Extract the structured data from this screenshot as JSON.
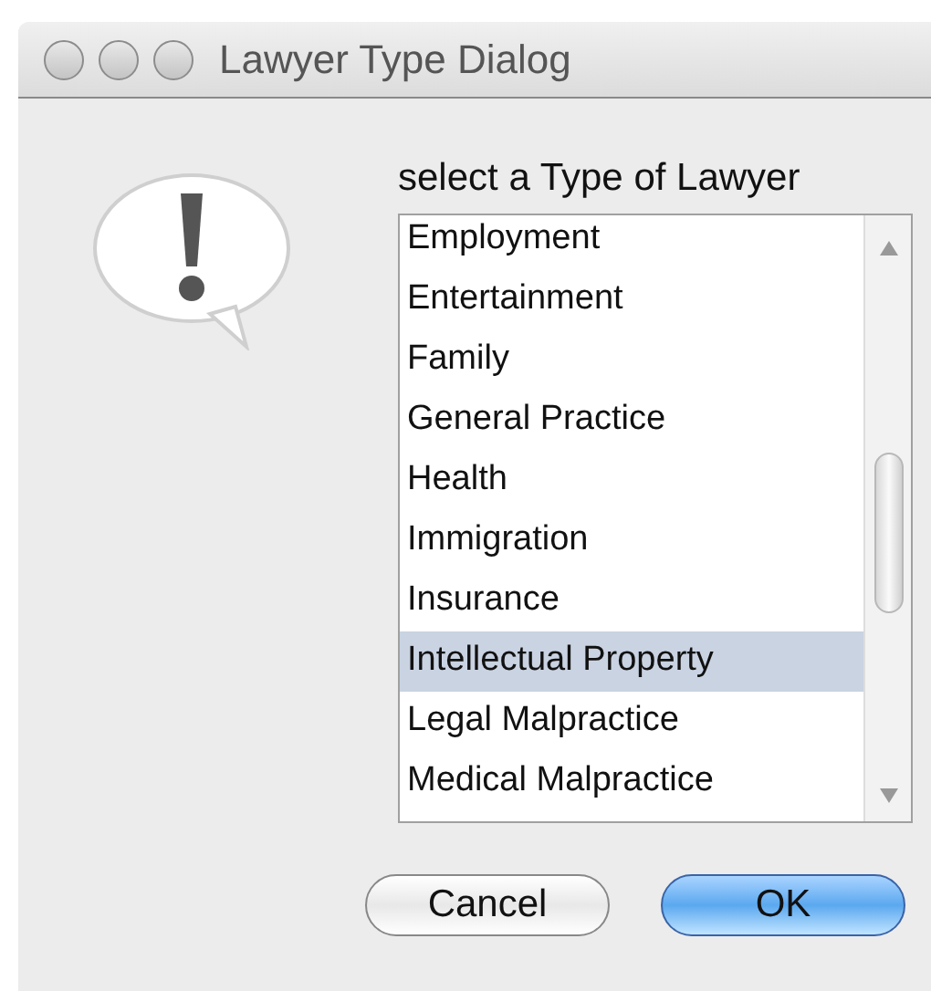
{
  "window": {
    "title": "Lawyer Type Dialog"
  },
  "prompt": "select a Type of Lawyer",
  "list": {
    "items": [
      {
        "label": "Employment",
        "selected": false
      },
      {
        "label": "Entertainment",
        "selected": false
      },
      {
        "label": "Family",
        "selected": false
      },
      {
        "label": "General Practice",
        "selected": false
      },
      {
        "label": "Health",
        "selected": false
      },
      {
        "label": "Immigration",
        "selected": false
      },
      {
        "label": "Insurance",
        "selected": false
      },
      {
        "label": "Intellectual Property",
        "selected": true
      },
      {
        "label": "Legal Malpractice",
        "selected": false
      },
      {
        "label": "Medical Malpractice",
        "selected": false
      }
    ]
  },
  "buttons": [
    {
      "label": "Cancel",
      "kind": "normal"
    },
    {
      "label": "OK",
      "kind": "default"
    }
  ]
}
